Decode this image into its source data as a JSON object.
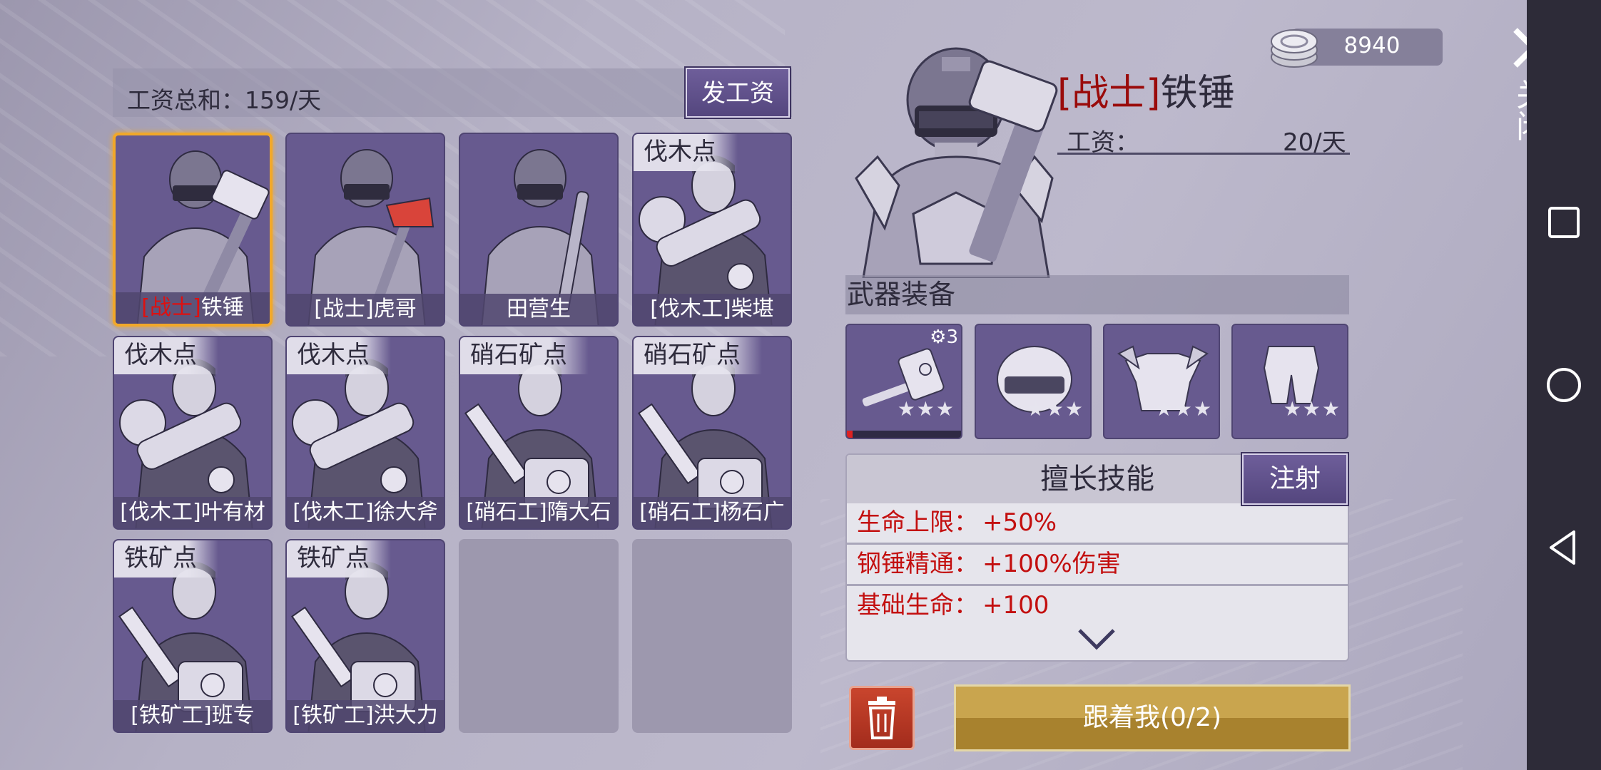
{
  "salary": {
    "label": "工资总和：159/天",
    "pay_button": "发工资"
  },
  "currency": {
    "value": "8940",
    "icon": "silver-coin-icon"
  },
  "workers": [
    {
      "name_prefix": "[战士]",
      "name": "铁锤",
      "location": "",
      "selected": true,
      "tool": "hammer"
    },
    {
      "name_prefix": "",
      "name": "[战士]虎哥",
      "location": "",
      "selected": false,
      "tool": "axe"
    },
    {
      "name_prefix": "",
      "name": "田营生",
      "location": "",
      "selected": false,
      "tool": "spiked-club"
    },
    {
      "name_prefix": "",
      "name": "[伐木工]柴堪",
      "location": "伐木点",
      "selected": false,
      "tool": "chainsaw"
    },
    {
      "name_prefix": "",
      "name": "[伐木工]叶有材",
      "location": "伐木点",
      "selected": false,
      "tool": "chainsaw"
    },
    {
      "name_prefix": "",
      "name": "[伐木工]徐大斧",
      "location": "伐木点",
      "selected": false,
      "tool": "chainsaw"
    },
    {
      "name_prefix": "",
      "name": "[硝石工]隋大石",
      "location": "硝石矿点",
      "selected": false,
      "tool": "drill"
    },
    {
      "name_prefix": "",
      "name": "[硝石工]杨石广",
      "location": "硝石矿点",
      "selected": false,
      "tool": "drill"
    },
    {
      "name_prefix": "",
      "name": "[铁矿工]班专",
      "location": "铁矿点",
      "selected": false,
      "tool": "drill"
    },
    {
      "name_prefix": "",
      "name": "[铁矿工]洪大力",
      "location": "铁矿点",
      "selected": false,
      "tool": "drill"
    }
  ],
  "detail": {
    "title_tag": "[战士]",
    "title_name": "铁锤",
    "wage_label": "工资：",
    "wage_value": "20/天",
    "equipment_header": "武器装备",
    "equipment": [
      {
        "icon": "hammer-icon",
        "stars": 3,
        "level": "3",
        "progress": 0.05
      },
      {
        "icon": "helmet-icon",
        "stars": 3
      },
      {
        "icon": "chest-armor-icon",
        "stars": 3
      },
      {
        "icon": "leg-armor-icon",
        "stars": 3
      }
    ],
    "skills_header": "擅长技能",
    "inject_button": "注射",
    "skills": [
      {
        "name": "生命上限：",
        "value": "+50%"
      },
      {
        "name": "钢锤精通：",
        "value": "+100%伤害"
      },
      {
        "name": "基础生命：",
        "value": "+100"
      }
    ],
    "follow_button": "跟着我(0/2)"
  },
  "close": {
    "label": "关闭"
  },
  "colors": {
    "card": "#675a8f",
    "selected_border": "#f1a82a",
    "skill_text": "#c30f0f",
    "follow": "#c9a54e",
    "trash": "#c9452d"
  }
}
